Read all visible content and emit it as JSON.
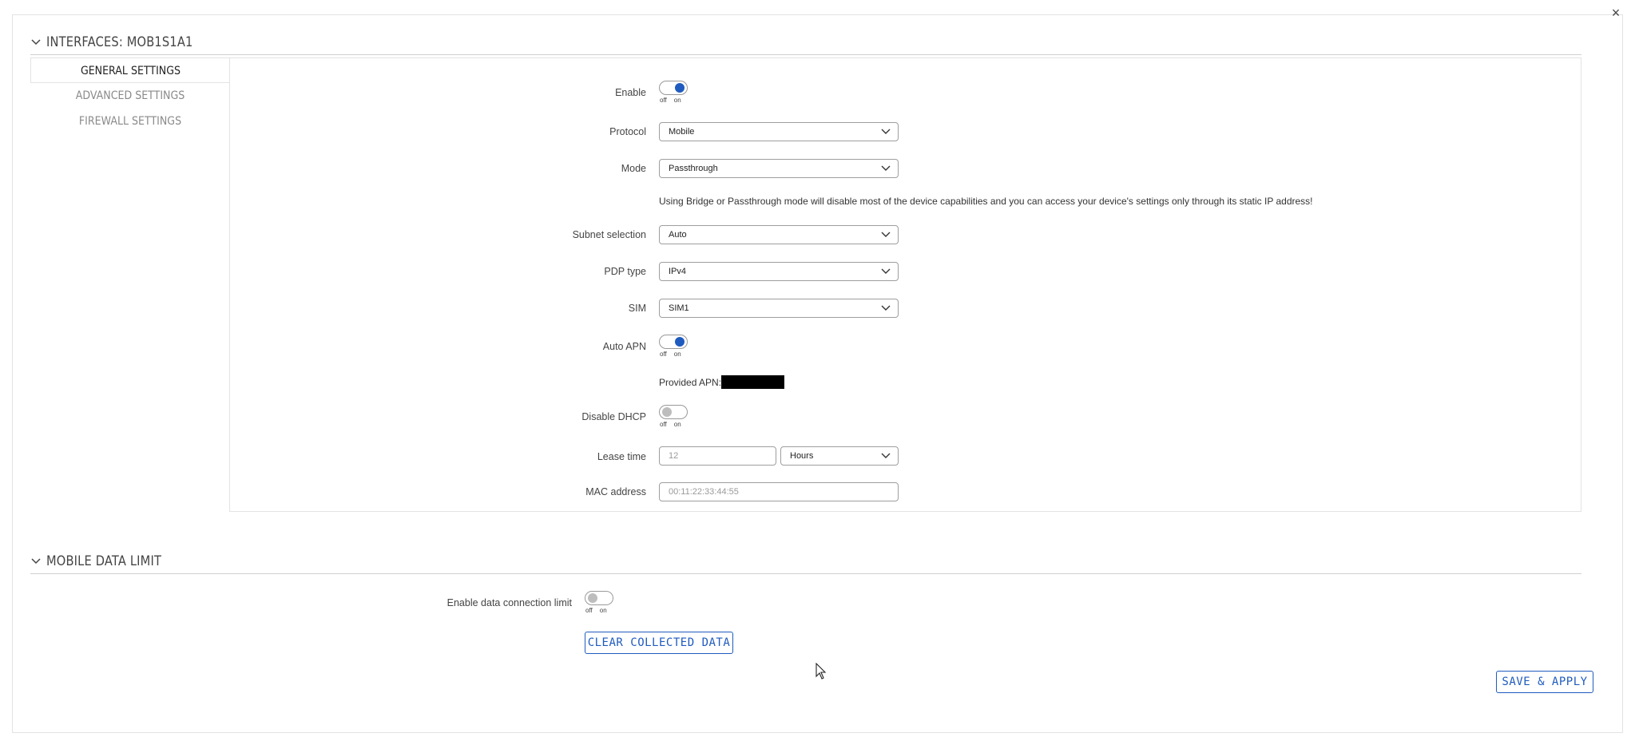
{
  "dialog": {
    "close_glyph": "×"
  },
  "interface_section": {
    "title": "INTERFACES: MOB1S1A1"
  },
  "tabs": [
    {
      "label": "GENERAL SETTINGS",
      "active": true
    },
    {
      "label": "ADVANCED SETTINGS",
      "active": false
    },
    {
      "label": "FIREWALL SETTINGS",
      "active": false
    }
  ],
  "toggle_labels": {
    "off": "off",
    "on": "on"
  },
  "general": {
    "enable": {
      "label": "Enable",
      "state": "on"
    },
    "protocol": {
      "label": "Protocol",
      "value": "Mobile"
    },
    "mode": {
      "label": "Mode",
      "value": "Passthrough"
    },
    "mode_note": "Using Bridge or Passthrough mode will disable most of the device capabilities and you can access your device's settings only through its static IP address!",
    "subnet": {
      "label": "Subnet selection",
      "value": "Auto"
    },
    "pdp": {
      "label": "PDP type",
      "value": "IPv4"
    },
    "sim": {
      "label": "SIM",
      "value": "SIM1"
    },
    "auto_apn": {
      "label": "Auto APN",
      "state": "on"
    },
    "provided_apn": "Provided APN:",
    "disable_dhcp": {
      "label": "Disable DHCP",
      "state": "off"
    },
    "lease_time": {
      "label": "Lease time",
      "value": "12",
      "unit": "Hours"
    },
    "mac": {
      "label": "MAC address",
      "placeholder": "00:11:22:33:44:55"
    }
  },
  "data_limit_section": {
    "title": "MOBILE DATA LIMIT",
    "enable_limit": {
      "label": "Enable data connection limit",
      "state": "off"
    },
    "clear_button": "CLEAR COLLECTED DATA"
  },
  "footer": {
    "save_button": "SAVE & APPLY"
  },
  "colors": {
    "accent": "#1f5bbf",
    "border": "#9e9e9e",
    "toggle_off": "#bdbdbd"
  },
  "icons": {
    "close": "close-icon",
    "chevron": "chevron-down-icon",
    "cursor": "mouse-pointer-icon"
  }
}
